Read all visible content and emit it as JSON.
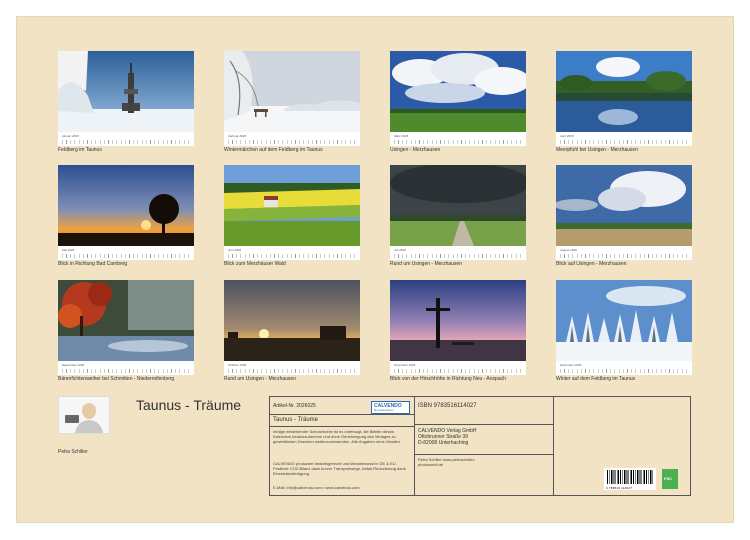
{
  "months": [
    {
      "label": "Januar 2026",
      "caption": "Feldberg im Taunus",
      "scene": "tower-winter"
    },
    {
      "label": "Februar 2026",
      "caption": "Wintermärchen auf dem Feldberg im Taunus",
      "scene": "snow-bench"
    },
    {
      "label": "März 2026",
      "caption": "Usingen - Merzhausen",
      "scene": "clouds-meadow"
    },
    {
      "label": "April 2026",
      "caption": "Meerpfuhl bei Usingen - Merzhausen",
      "scene": "lake-reflection"
    },
    {
      "label": "Mai 2026",
      "caption": "Blick in Richtung Bad Camberg",
      "scene": "sunset-tree"
    },
    {
      "label": "Juni 2026",
      "caption": "Blick zum Merzhäuser Wald",
      "scene": "rapeseed-field"
    },
    {
      "label": "Juli 2026",
      "caption": "Rund um Usingen - Merzhausen",
      "scene": "storm-field"
    },
    {
      "label": "August 2026",
      "caption": "Blick auf Usingen - Merzhausen",
      "scene": "cumulus-field"
    },
    {
      "label": "September 2026",
      "caption": "Bärenfichtenweiher bei Schmitten - Niederreifenberg",
      "scene": "autumn-pond"
    },
    {
      "label": "Oktober 2026",
      "caption": "Rund um Usingen - Merzhausen",
      "scene": "sunset-hut"
    },
    {
      "label": "November 2026",
      "caption": "Blick von der Hirschhöhe in Richtung Neu - Anspach",
      "scene": "cross-dusk"
    },
    {
      "label": "Dezember 2026",
      "caption": "Winter auf dem Feldberg im Taunus",
      "scene": "snow-forest"
    }
  ],
  "cover": {
    "title": "Taunus - Träume",
    "author": "Petra Schiller"
  },
  "info": {
    "article": "Artikel-Nr. 2026025",
    "logo_text": "CALVENDO",
    "logo_sub": "Ein Unternehmen",
    "title": "Taunus - Träume",
    "para1": "Infolge bestehender Schutzrechte ist es untersagt, die Blätter dieses Kalenders herauszutrennen und ohne Genehmigung des Verlages zu gewerblichen Zwecken weiterzuverwenden. Alle Angaben ohne Gewähr.",
    "para2": "CALVENDO produziert bedarfsgerecht und klimabewusst in DE & EU. Postfreie CO2-Bilanz dank kurzer Transportwege, Abfall-Reduzierung dank Einzelstückfertigung.",
    "email": "E-Mail: info@calvendo.com • www.calvendo.com",
    "isbn": "ISBN 9783516114027",
    "publisher_name": "CALVENDO Verlag GmbH",
    "publisher_street": "Ottobrunner Straße 39",
    "publisher_city": "D-82008 Unterhaching",
    "owner_line1": "Petra Schiller www.petraschiller-",
    "owner_line2": "photoworld.de",
    "barcode_number": "9 783516 114027",
    "green_logo": "FSC"
  }
}
